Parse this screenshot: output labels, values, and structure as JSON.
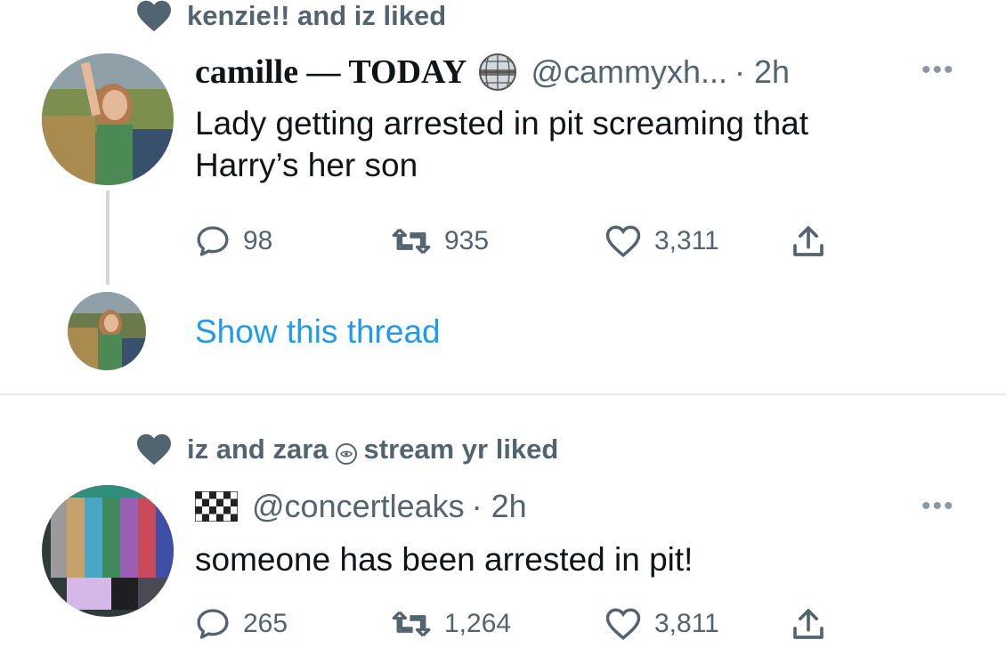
{
  "tweet1": {
    "liked_by": "kenzie!! and iz liked",
    "display_name": "camille — TODAY",
    "handle": "@cammyxh...",
    "time": "· 2h",
    "text_line1": "Lady getting arrested in pit screaming that",
    "text_line2": "Harry’s her son",
    "replies": "98",
    "retweets": "935",
    "likes": "3,311",
    "more": "•••",
    "show_thread": "Show this thread"
  },
  "tweet2": {
    "liked_by_a": "iz and zara",
    "liked_by_b": "stream yr liked",
    "handle": "@concertleaks",
    "time": "· 2h",
    "text": "someone has been arrested in pit!",
    "replies": "265",
    "retweets": "1,264",
    "likes": "3,811",
    "more": "•••"
  },
  "icons": {
    "heart": "heart-icon",
    "reply": "reply-icon",
    "retweet": "retweet-icon",
    "like": "like-icon",
    "share": "share-icon",
    "disco_ball": "disco-ball-icon",
    "checkered_flag": "checkered-flag-icon"
  },
  "colors": {
    "link_blue": "#1d9bf0",
    "secondary_text": "#536471",
    "primary_text": "#0f1419"
  }
}
